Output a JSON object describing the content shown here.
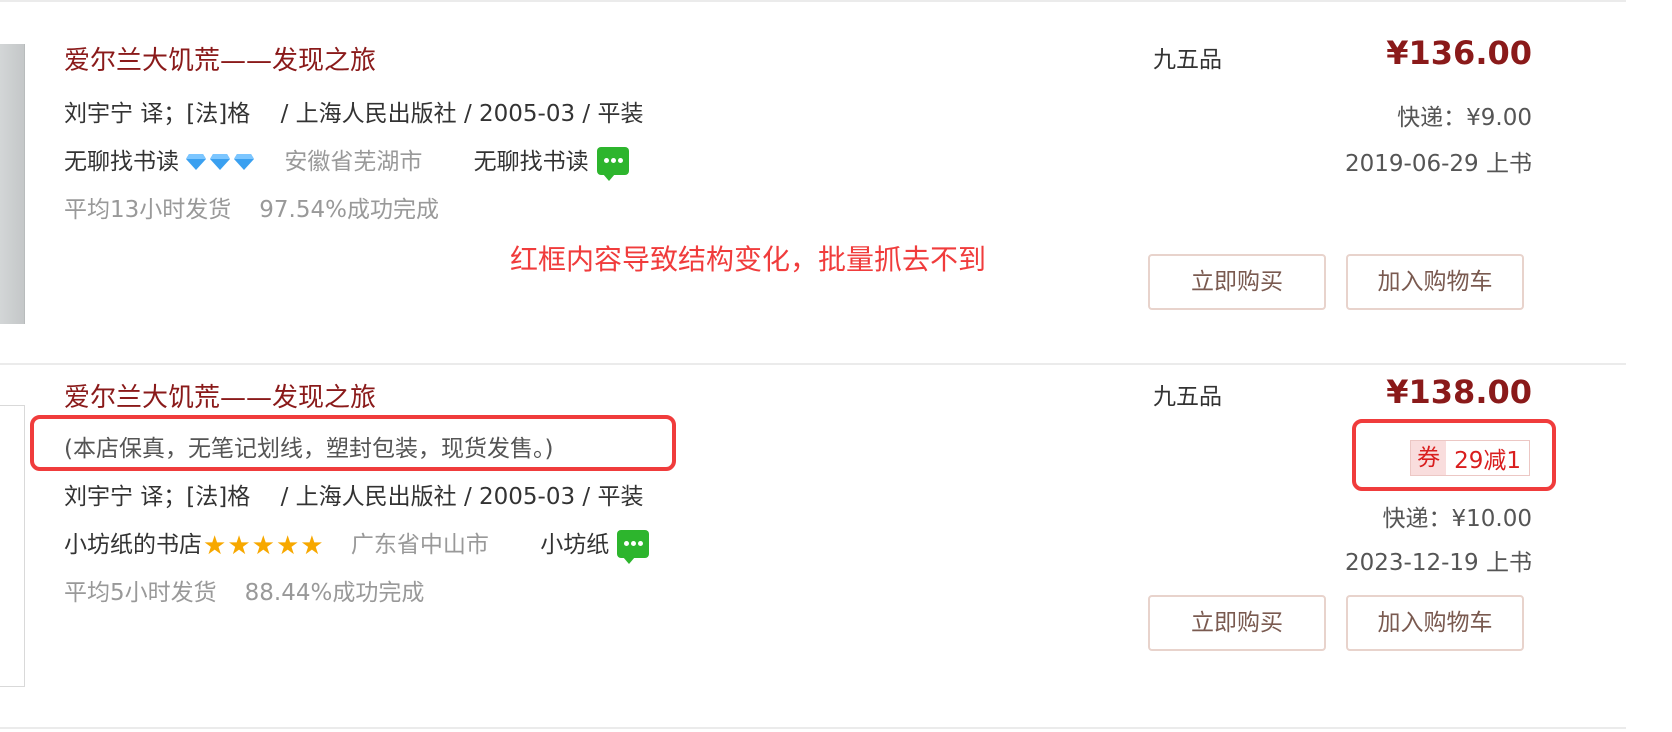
{
  "annotation": "红框内容导致结构变化，批量抓去不到",
  "items": [
    {
      "title": "爱尔兰大饥荒——发现之旅",
      "pub_info": "刘宇宁 译；[法]格 　/ 上海人民出版社 / 2005-03 / 平装",
      "shop_name": "无聊找书读",
      "shop_badge": "diamond-icon",
      "shop_badge_count": 3,
      "location": "安徽省芜湖市",
      "seller": "无聊找书读",
      "ship_time": "平均13小时发货",
      "success_rate": "97.54%成功完成",
      "condition": "九五品",
      "price": "¥136.00",
      "shipping": "快递：¥9.00",
      "listed": "2019-06-29 上书",
      "buy_label": "立即购买",
      "cart_label": "加入购物车"
    },
    {
      "title": "爱尔兰大饥荒——发现之旅",
      "note": "(本店保真，无笔记划线，塑封包装，现货发售。)",
      "pub_info": "刘宇宁 译；[法]格 　/ 上海人民出版社 / 2005-03 / 平装",
      "shop_name": "小坊纸的书店",
      "shop_badge": "star-icon",
      "shop_badge_count": 5,
      "location": "广东省中山市",
      "seller": "小坊纸",
      "ship_time": "平均5小时发货",
      "success_rate": "88.44%成功完成",
      "condition": "九五品",
      "price": "¥138.00",
      "coupon_tag": "券",
      "coupon_value": "29减1",
      "shipping": "快递：¥10.00",
      "listed": "2023-12-19 上书",
      "buy_label": "立即购买",
      "cart_label": "加入购物车"
    }
  ],
  "colors": {
    "title": "#8a1a1a",
    "price": "#8a1a1a",
    "annotation": "#f03c3c",
    "chat_icon": "#2db52d",
    "star": "#f7a800",
    "diamond": "#3aa0f0"
  }
}
